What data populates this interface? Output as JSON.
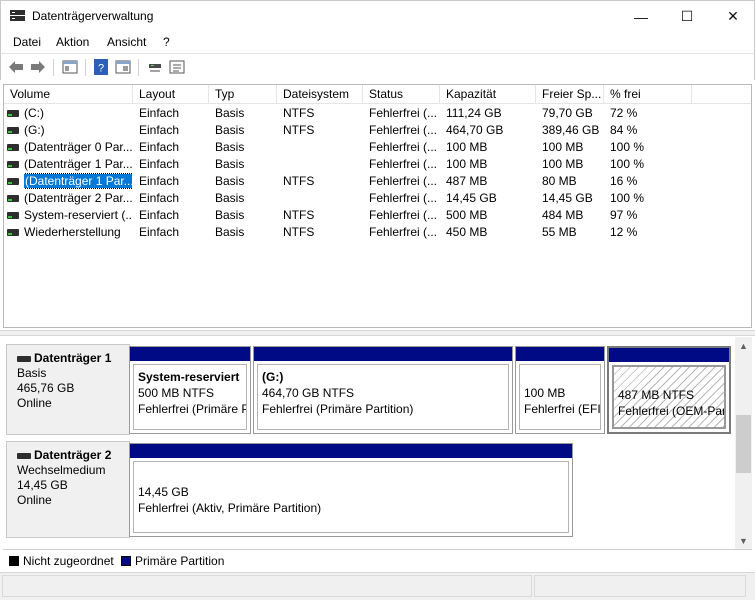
{
  "window": {
    "title": "Datenträgerverwaltung",
    "minimize_glyph": "—",
    "maximize_glyph": "☐",
    "close_glyph": "✕"
  },
  "menu": {
    "items": [
      "Datei",
      "Aktion",
      "Ansicht",
      "?"
    ]
  },
  "toolbar": {
    "icons": [
      "back-arrow-icon",
      "forward-arrow-icon",
      "properties-icon",
      "help-icon",
      "console-tree-icon",
      "connect-icon",
      "list-icon"
    ]
  },
  "volume_table": {
    "columns": [
      "Volume",
      "Layout",
      "Typ",
      "Dateisystem",
      "Status",
      "Kapazität",
      "Freier Sp...",
      "% frei"
    ],
    "rows": [
      {
        "volume": "(C:)",
        "layout": "Einfach",
        "type": "Basis",
        "fs": "NTFS",
        "status": "Fehlerfrei (...",
        "capacity": "111,24 GB",
        "free": "79,70 GB",
        "pct": "72 %",
        "selected": false
      },
      {
        "volume": "(G:)",
        "layout": "Einfach",
        "type": "Basis",
        "fs": "NTFS",
        "status": "Fehlerfrei (...",
        "capacity": "464,70 GB",
        "free": "389,46 GB",
        "pct": "84 %",
        "selected": false
      },
      {
        "volume": "(Datenträger 0 Par...",
        "layout": "Einfach",
        "type": "Basis",
        "fs": "",
        "status": "Fehlerfrei (...",
        "capacity": "100 MB",
        "free": "100 MB",
        "pct": "100 %",
        "selected": false
      },
      {
        "volume": "(Datenträger 1 Par...",
        "layout": "Einfach",
        "type": "Basis",
        "fs": "",
        "status": "Fehlerfrei (...",
        "capacity": "100 MB",
        "free": "100 MB",
        "pct": "100 %",
        "selected": false
      },
      {
        "volume": "(Datenträger 1 Par...",
        "layout": "Einfach",
        "type": "Basis",
        "fs": "NTFS",
        "status": "Fehlerfrei (...",
        "capacity": "487 MB",
        "free": "80 MB",
        "pct": "16 %",
        "selected": true
      },
      {
        "volume": "(Datenträger 2 Par...",
        "layout": "Einfach",
        "type": "Basis",
        "fs": "",
        "status": "Fehlerfrei (...",
        "capacity": "14,45 GB",
        "free": "14,45 GB",
        "pct": "100 %",
        "selected": false
      },
      {
        "volume": "System-reserviert (...",
        "layout": "Einfach",
        "type": "Basis",
        "fs": "NTFS",
        "status": "Fehlerfrei (...",
        "capacity": "500 MB",
        "free": "484 MB",
        "pct": "97 %",
        "selected": false
      },
      {
        "volume": "Wiederherstellung",
        "layout": "Einfach",
        "type": "Basis",
        "fs": "NTFS",
        "status": "Fehlerfrei (...",
        "capacity": "450 MB",
        "free": "55 MB",
        "pct": "12 %",
        "selected": false
      }
    ]
  },
  "disks": [
    {
      "name": "Datenträger 1",
      "type": "Basis",
      "size": "465,76 GB",
      "state": "Online",
      "partitions": [
        {
          "name": "System-reserviert",
          "size": "500 MB NTFS",
          "status": "Fehlerfrei (Primäre P",
          "style": "normal"
        },
        {
          "name": "(G:)",
          "size": "464,70 GB NTFS",
          "status": "Fehlerfrei (Primäre Partition)",
          "style": "normal"
        },
        {
          "name": "",
          "size": "100 MB",
          "status": "Fehlerfrei (EFI-",
          "style": "normal"
        },
        {
          "name": "",
          "size": "487 MB NTFS",
          "status": "Fehlerfrei (OEM-Parti",
          "style": "hatched"
        }
      ]
    },
    {
      "name": "Datenträger 2",
      "type": "Wechselmedium",
      "size": "14,45 GB",
      "state": "Online",
      "partitions": [
        {
          "name": "",
          "size": "14,45 GB",
          "status": "Fehlerfrei (Aktiv, Primäre Partition)",
          "style": "normal"
        }
      ]
    }
  ],
  "legend": {
    "items": [
      {
        "label": "Nicht zugeordnet",
        "color": "#000000"
      },
      {
        "label": "Primäre Partition",
        "color": "#000a85"
      }
    ]
  },
  "colors": {
    "primary_partition": "#000a85",
    "selection": "#0078d7"
  }
}
